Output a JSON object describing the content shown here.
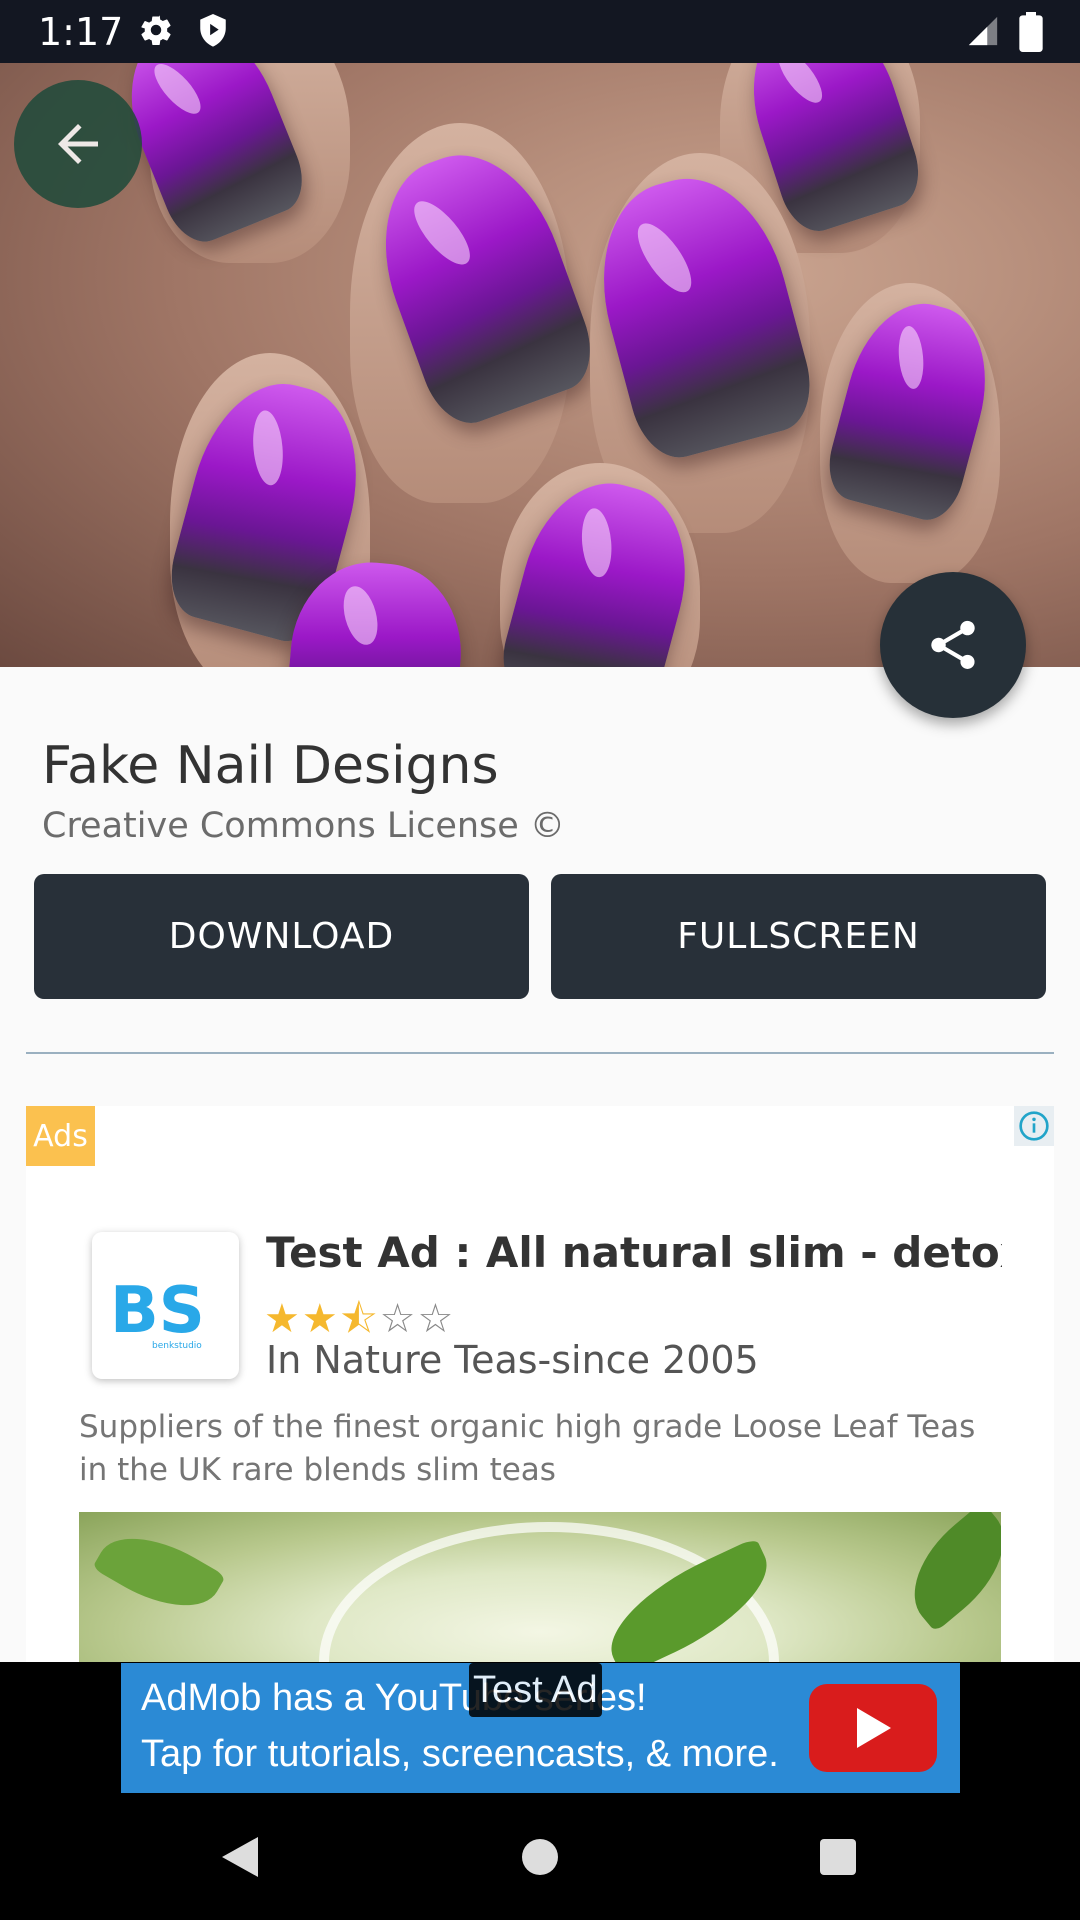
{
  "status_bar": {
    "time": "1:17"
  },
  "header": {
    "back_icon": "arrow-left-icon"
  },
  "hero": {
    "image": "purple-glitter-nails-photo"
  },
  "fab": {
    "icon": "share-icon"
  },
  "details": {
    "title": "Fake Nail Designs",
    "license": "Creative Commons License ©"
  },
  "actions": {
    "download_label": "DOWNLOAD",
    "fullscreen_label": "FULLSCREEN"
  },
  "ad": {
    "badge": "Ads",
    "title": "Test Ad : All natural slim - detox tea",
    "rating": 2.5,
    "stars": [
      "★",
      "★",
      "⯪",
      "☆",
      "☆"
    ],
    "advertiser": "In Nature Teas-since 2005",
    "body": "Suppliers of the finest organic high grade Loose Leaf Teas in the UK rare blends slim teas",
    "logo_text": "BS",
    "logo_caption": "benkstudio"
  },
  "banner": {
    "line1": "AdMob has a YouTube series!",
    "line2": "Tap for tutorials, screencasts, & more.",
    "test_label": "Test Ad"
  },
  "colors": {
    "primary_dark": "#283039",
    "ad_badge": "#fbc14f",
    "banner_blue": "#2b8ad5",
    "youtube_red": "#d91c1c"
  }
}
